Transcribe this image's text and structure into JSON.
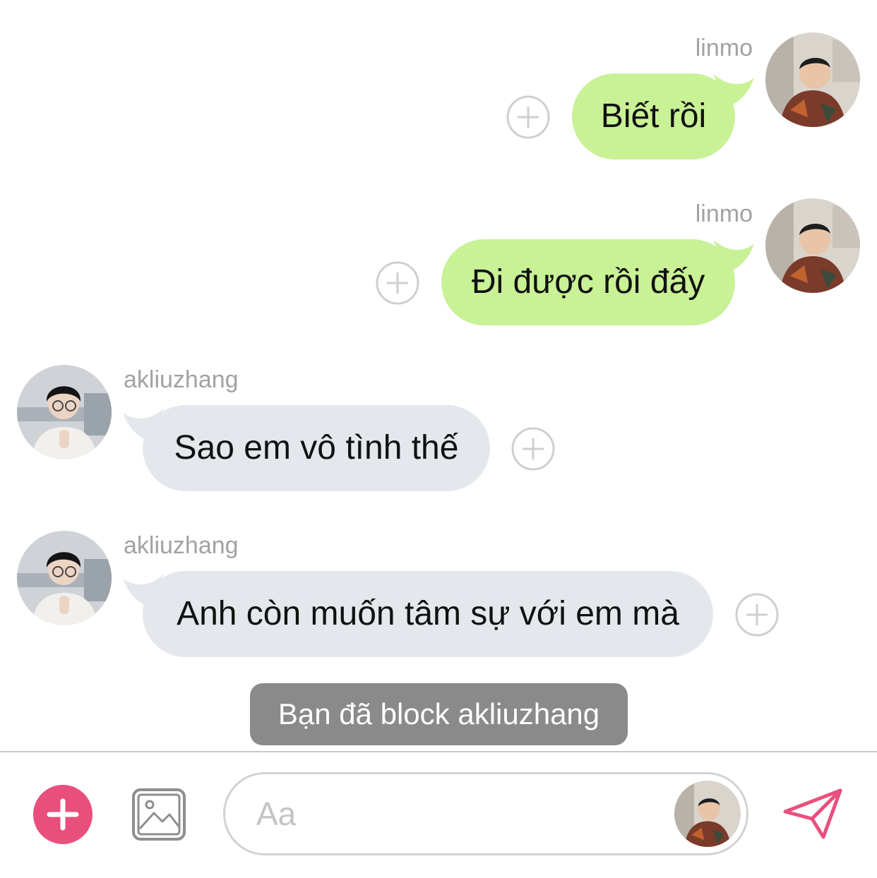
{
  "messages": [
    {
      "sender": "linmo",
      "text": "Biết rồi"
    },
    {
      "sender": "linmo",
      "text": "Đi được rồi đấy"
    },
    {
      "sender": "akliuzhang",
      "text": "Sao em vô tình thế"
    },
    {
      "sender": "akliuzhang",
      "text": "Anh còn muốn tâm sự với em mà"
    }
  ],
  "notice": "Bạn đã block akliuzhang",
  "composer": {
    "placeholder": "Aa"
  },
  "icons": {
    "add": "plus-circle-icon",
    "gallery": "image-icon",
    "send": "paper-plane-icon",
    "react": "add-reaction-icon"
  },
  "colors": {
    "my_bubble": "#c9f196",
    "their_bubble": "#e4e8ec",
    "accent": "#e94f7d",
    "notice_bg": "#8a8a8a"
  }
}
